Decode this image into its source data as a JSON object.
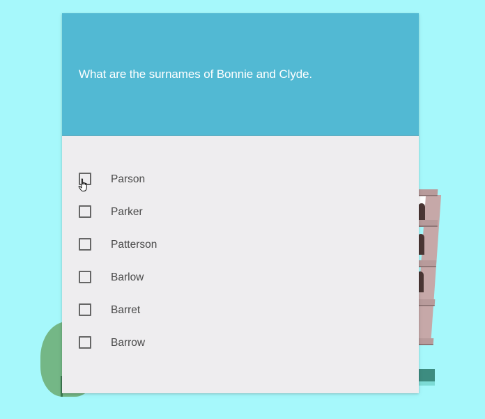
{
  "quiz": {
    "question": "What are the surnames of Bonnie and Clyde.",
    "options": [
      {
        "label": "Parson",
        "checked": false
      },
      {
        "label": "Parker",
        "checked": false
      },
      {
        "label": "Patterson",
        "checked": false
      },
      {
        "label": "Barlow",
        "checked": false
      },
      {
        "label": "Barret",
        "checked": false
      },
      {
        "label": "Barrow",
        "checked": false
      }
    ]
  },
  "colors": {
    "background": "#a6f8fb",
    "header": "#52b9d3",
    "card": "#eeedef",
    "text": "#4a4a4a"
  },
  "icons": {
    "cursor": "hand-pointer-icon",
    "checkbox": "checkbox-unchecked-icon"
  }
}
